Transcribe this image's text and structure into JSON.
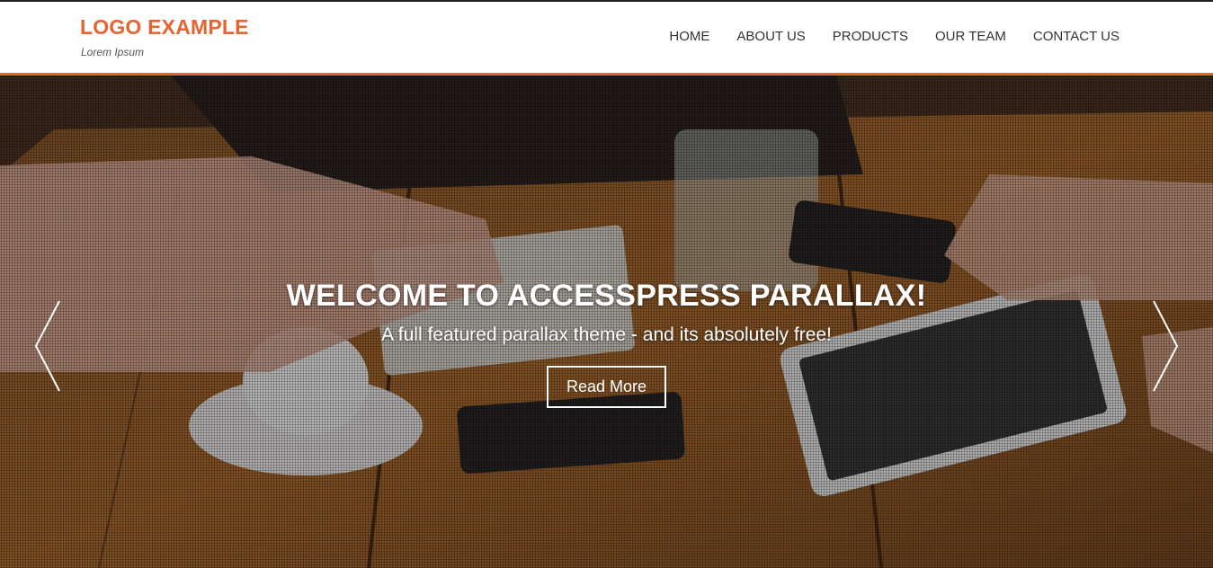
{
  "header": {
    "logo_title": "LOGO EXAMPLE",
    "logo_tagline": "Lorem Ipsum",
    "nav": [
      {
        "label": "HOME"
      },
      {
        "label": "ABOUT US"
      },
      {
        "label": "PRODUCTS"
      },
      {
        "label": "OUR TEAM"
      },
      {
        "label": "CONTACT US"
      }
    ]
  },
  "slider": {
    "title": "WELCOME TO ACCESSPRESS PARALLAX!",
    "subtitle": "A full featured parallax theme - and its absolutely free!",
    "button_label": "Read More",
    "prev_icon": "chevron-left-icon",
    "next_icon": "chevron-right-icon"
  },
  "colors": {
    "accent": "#e66432",
    "header_bg": "#ffffff",
    "nav_text": "#333333",
    "caption_text": "#ffffff"
  }
}
